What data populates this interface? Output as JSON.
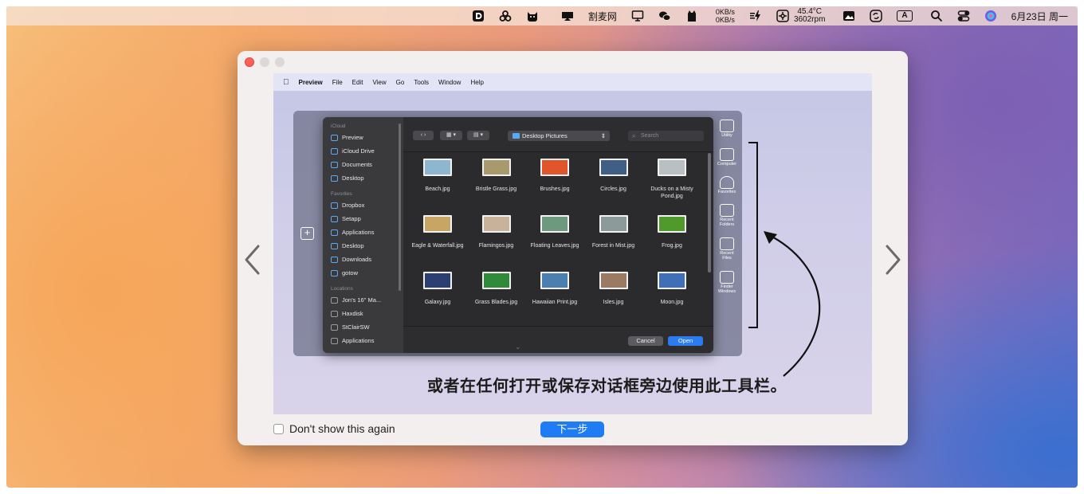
{
  "menubar": {
    "wangpan": "割麦网",
    "net_up": "0KB/s",
    "net_down": "0KB/s",
    "temp": "45.4°C",
    "rpm": "3602rpm",
    "input_method": "A",
    "datetime": "6月23日 周一"
  },
  "preview_menubar": {
    "app": "Preview",
    "items": [
      "File",
      "Edit",
      "View",
      "Go",
      "Tools",
      "Window",
      "Help"
    ]
  },
  "dialog": {
    "sidebar": {
      "icloud_header": "iCloud",
      "icloud_items": [
        "Preview",
        "iCloud Drive",
        "Documents",
        "Desktop"
      ],
      "favorites_header": "Favorites",
      "favorites_items": [
        "Dropbox",
        "Setapp",
        "Applications",
        "Desktop",
        "Downloads",
        "gotow"
      ],
      "locations_header": "Locations",
      "locations_items": [
        "Jon's 16\" Ma...",
        "Haxdisk",
        "StClairSW",
        "Applications"
      ]
    },
    "path": "Desktop Pictures",
    "search_placeholder": "Search",
    "files": [
      {
        "name": "Beach.jpg",
        "color": "#8fb6cf"
      },
      {
        "name": "Bristle Grass.jpg",
        "color": "#a89a6c"
      },
      {
        "name": "Brushes.jpg",
        "color": "#e0562a"
      },
      {
        "name": "Circles.jpg",
        "color": "#3f5f86"
      },
      {
        "name": "Ducks on a Misty Pond.jpg",
        "color": "#b8c0c4"
      },
      {
        "name": "Eagle & Waterfall.jpg",
        "color": "#c8a565"
      },
      {
        "name": "Flamingos.jpg",
        "color": "#c9b29a"
      },
      {
        "name": "Floating Leaves.jpg",
        "color": "#6d9a7e"
      },
      {
        "name": "Forest in Mist.jpg",
        "color": "#8c9a9a"
      },
      {
        "name": "Frog.jpg",
        "color": "#4f9a2a"
      },
      {
        "name": "Galaxy.jpg",
        "color": "#2d3f72"
      },
      {
        "name": "Grass Blades.jpg",
        "color": "#2f8a3a"
      },
      {
        "name": "Hawaiian Print.jpg",
        "color": "#4b7fb0"
      },
      {
        "name": "Isles.jpg",
        "color": "#9a7a62"
      },
      {
        "name": "Moon.jpg",
        "color": "#3f6fb8"
      }
    ],
    "cancel_label": "Cancel",
    "open_label": "Open"
  },
  "toolbar_strip": [
    "Utility",
    "Computer",
    "Favorites",
    "Recent Folders",
    "Recent Files",
    "Finder Windows"
  ],
  "caption": "或者在任何打开或保存对话框旁边使用此工具栏。",
  "footer": {
    "checkbox_label": "Don't show this again",
    "next_label": "下一步"
  },
  "colors": {
    "accent": "#1f7cf5",
    "close": "#fe5f57"
  }
}
